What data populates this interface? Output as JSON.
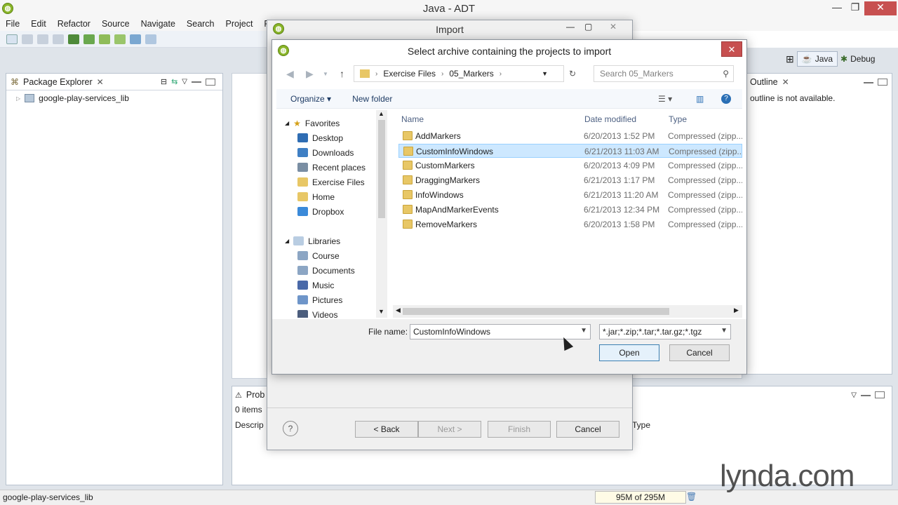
{
  "main_window": {
    "title": "Java - ADT",
    "menu": [
      "File",
      "Edit",
      "Refactor",
      "Source",
      "Navigate",
      "Search",
      "Project",
      "Run"
    ]
  },
  "perspectives": {
    "java": "Java",
    "debug": "Debug"
  },
  "package_explorer": {
    "tab_label": "Package Explorer",
    "tree": [
      {
        "label": "google-play-services_lib"
      }
    ]
  },
  "outline": {
    "tab_label": "Outline",
    "message": "outline is not available."
  },
  "problems": {
    "tab_label": "Prob",
    "count": "0 items",
    "columns": [
      "Descrip",
      "Type"
    ]
  },
  "status_bar": {
    "selection": "google-play-services_lib",
    "heap": "95M of 295M"
  },
  "import_wizard": {
    "title": "Import",
    "buttons": {
      "back": "< Back",
      "next": "Next >",
      "finish": "Finish",
      "cancel": "Cancel"
    }
  },
  "file_dialog": {
    "title": "Select archive containing the projects to import",
    "breadcrumb": [
      "Exercise Files",
      "05_Markers"
    ],
    "search_placeholder": "Search 05_Markers",
    "commands": {
      "organize": "Organize",
      "new_folder": "New folder"
    },
    "nav": {
      "favorites_header": "Favorites",
      "favorites": [
        "Desktop",
        "Downloads",
        "Recent places",
        "Exercise Files",
        "Home",
        "Dropbox"
      ],
      "libraries_header": "Libraries",
      "libraries": [
        "Course",
        "Documents",
        "Music",
        "Pictures",
        "Videos"
      ]
    },
    "columns": {
      "name": "Name",
      "date": "Date modified",
      "type": "Type"
    },
    "files": [
      {
        "name": "AddMarkers",
        "date": "6/20/2013 1:52 PM",
        "type": "Compressed (zipp..."
      },
      {
        "name": "CustomInfoWindows",
        "date": "6/21/2013 11:03 AM",
        "type": "Compressed (zipp..."
      },
      {
        "name": "CustomMarkers",
        "date": "6/20/2013 4:09 PM",
        "type": "Compressed (zipp..."
      },
      {
        "name": "DraggingMarkers",
        "date": "6/21/2013 1:17 PM",
        "type": "Compressed (zipp..."
      },
      {
        "name": "InfoWindows",
        "date": "6/21/2013 11:20 AM",
        "type": "Compressed (zipp..."
      },
      {
        "name": "MapAndMarkerEvents",
        "date": "6/21/2013 12:34 PM",
        "type": "Compressed (zipp..."
      },
      {
        "name": "RemoveMarkers",
        "date": "6/20/2013 1:58 PM",
        "type": "Compressed (zipp..."
      }
    ],
    "selected_file": "CustomInfoWindows",
    "file_name_label": "File name:",
    "file_name_value": "CustomInfoWindows",
    "filter_value": "*.jar;*.zip;*.tar;*.tar.gz;*.tgz",
    "buttons": {
      "open": "Open",
      "cancel": "Cancel"
    }
  },
  "watermark": "lynda.com",
  "colors": {
    "accent_selection": "#cde8ff",
    "close_red": "#c75050",
    "app_green": "#8ab529"
  }
}
